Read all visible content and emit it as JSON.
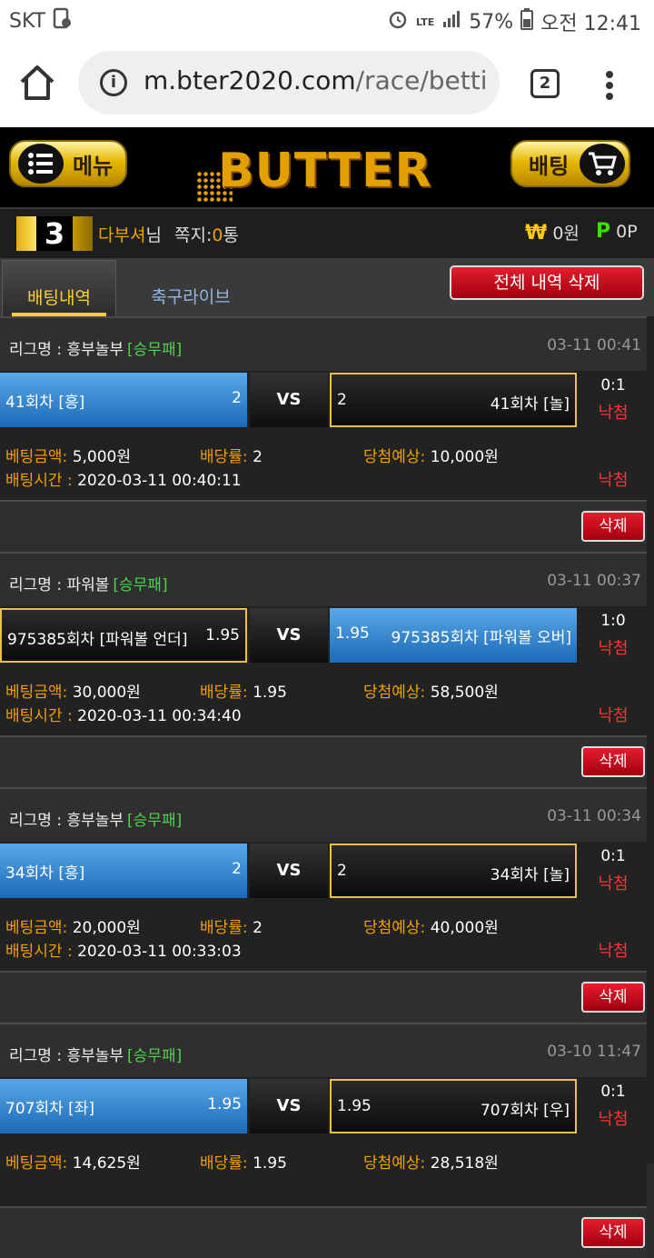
{
  "status_bar": {
    "carrier": "SKT",
    "network": "LTE",
    "battery": "57%",
    "time": "오전 12:41"
  },
  "browser": {
    "url_domain": "m.bter2020.com",
    "url_path": "/race/betti",
    "tab_count": "2"
  },
  "header": {
    "menu_label": "메뉴",
    "logo_text": "BUTTER",
    "bet_label": "배팅"
  },
  "user": {
    "level": "3",
    "name": "다부셔",
    "name_suffix": "님",
    "mail_label": "쪽지:",
    "mail_count": "0",
    "mail_unit": "통",
    "money_symbol": "₩",
    "money": "0원",
    "point_symbol": "P",
    "points": "0P"
  },
  "tabs": {
    "active": "배팅내역",
    "other": "축구라이브",
    "delete_all": "전체 내역 삭제"
  },
  "labels": {
    "league": "리그명 :",
    "amount": "베팅금액:",
    "amount_alt": "베팅금액:",
    "odds": "배당률:",
    "expected": "당첨예상:",
    "bet_time": "배팅시간 :",
    "vs": "VS",
    "delete": "삭제"
  },
  "bets": [
    {
      "league": "흥부놀부",
      "type": "[승무패]",
      "time": "03-11 00:41",
      "left_team": "41회차 [흥]",
      "left_odd": "2",
      "left_style": "blue",
      "right_team": "41회차 [놀]",
      "right_odd": "2",
      "right_style": "dark",
      "score": "0:1",
      "result": "낙첨",
      "amount_label": "베팅금액:",
      "amount": "5,000원",
      "odds": "2",
      "expected": "10,000원",
      "bet_time": "2020-03-11 00:40:11",
      "result2": "낙첨"
    },
    {
      "league": "파워볼",
      "type": "[승무패]",
      "time": "03-11 00:37",
      "left_team": "975385회차 [파워볼 언더]",
      "left_odd": "1.95",
      "left_style": "dark",
      "right_team": "975385회차 [파워볼 오버]",
      "right_odd": "1.95",
      "right_style": "blue",
      "score": "1:0",
      "result": "낙첨",
      "amount_label": "베팅금액:",
      "amount": "30,000원",
      "odds": "1.95",
      "expected": "58,500원",
      "bet_time": "2020-03-11 00:34:40",
      "result2": "낙첨"
    },
    {
      "league": "흥부놀부",
      "type": "[승무패]",
      "time": "03-11 00:34",
      "left_team": "34회차 [흥]",
      "left_odd": "2",
      "left_style": "blue",
      "right_team": "34회차 [놀]",
      "right_odd": "2",
      "right_style": "dark",
      "score": "0:1",
      "result": "낙첨",
      "amount_label": "베팅금액:",
      "amount": "20,000원",
      "odds": "2",
      "expected": "40,000원",
      "bet_time": "2020-03-11 00:33:03",
      "result2": "낙첨"
    },
    {
      "league": "흥부놀부",
      "type": "[승무패]",
      "time": "03-10 11:47",
      "left_team": "707회차 [좌]",
      "left_odd": "1.95",
      "left_style": "blue",
      "right_team": "707회차 [우]",
      "right_odd": "1.95",
      "right_style": "dark",
      "score": "0:1",
      "result": "낙첨",
      "amount_label": "베팅금액:",
      "amount": "14,625원",
      "odds": "1.95",
      "expected": "28,518원",
      "bet_time": "",
      "result2": ""
    }
  ]
}
